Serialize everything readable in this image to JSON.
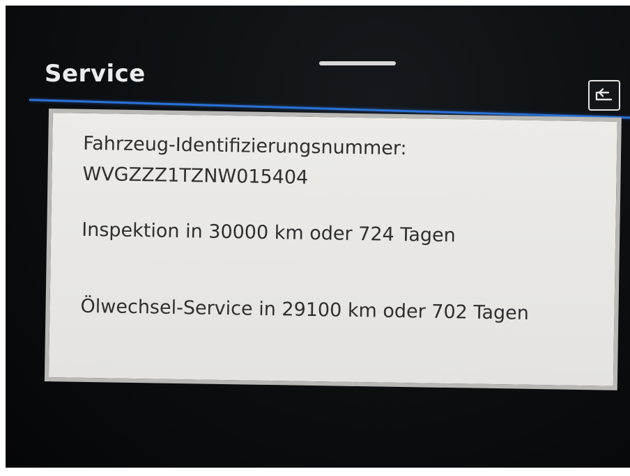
{
  "header": {
    "title": "Service"
  },
  "panel": {
    "vin_label": "Fahrzeug-Identifizierungsnummer:",
    "vin_value": "WVGZZZ1TZNW015404",
    "inspection_text": "Inspektion in 30000 km oder 724 Tagen",
    "oil_service_text": "Ölwechsel-Service in 29100 km oder 702 Tagen"
  },
  "icons": {
    "back": "back-arrow-icon"
  },
  "colors": {
    "accent_line": "#2a72d8",
    "panel_background": "#ecebe8",
    "screen_background": "#0c0e10"
  }
}
